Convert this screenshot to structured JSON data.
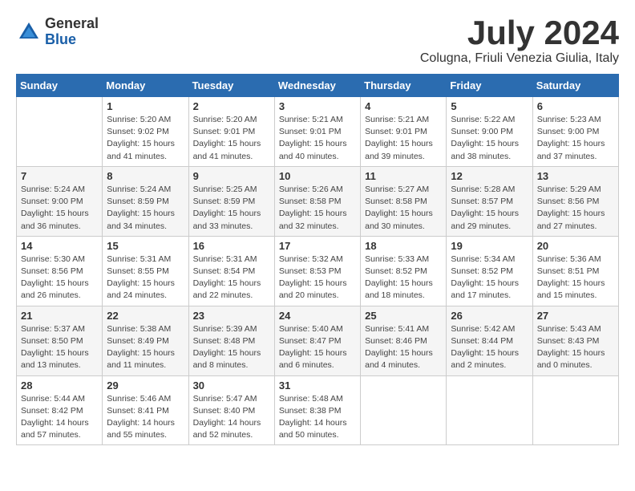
{
  "header": {
    "logo": {
      "general": "General",
      "blue": "Blue"
    },
    "title": "July 2024",
    "location": "Colugna, Friuli Venezia Giulia, Italy"
  },
  "calendar": {
    "weekdays": [
      "Sunday",
      "Monday",
      "Tuesday",
      "Wednesday",
      "Thursday",
      "Friday",
      "Saturday"
    ],
    "weeks": [
      [
        {
          "day": "",
          "info": ""
        },
        {
          "day": "1",
          "info": "Sunrise: 5:20 AM\nSunset: 9:02 PM\nDaylight: 15 hours\nand 41 minutes."
        },
        {
          "day": "2",
          "info": "Sunrise: 5:20 AM\nSunset: 9:01 PM\nDaylight: 15 hours\nand 41 minutes."
        },
        {
          "day": "3",
          "info": "Sunrise: 5:21 AM\nSunset: 9:01 PM\nDaylight: 15 hours\nand 40 minutes."
        },
        {
          "day": "4",
          "info": "Sunrise: 5:21 AM\nSunset: 9:01 PM\nDaylight: 15 hours\nand 39 minutes."
        },
        {
          "day": "5",
          "info": "Sunrise: 5:22 AM\nSunset: 9:00 PM\nDaylight: 15 hours\nand 38 minutes."
        },
        {
          "day": "6",
          "info": "Sunrise: 5:23 AM\nSunset: 9:00 PM\nDaylight: 15 hours\nand 37 minutes."
        }
      ],
      [
        {
          "day": "7",
          "info": "Sunrise: 5:24 AM\nSunset: 9:00 PM\nDaylight: 15 hours\nand 36 minutes."
        },
        {
          "day": "8",
          "info": "Sunrise: 5:24 AM\nSunset: 8:59 PM\nDaylight: 15 hours\nand 34 minutes."
        },
        {
          "day": "9",
          "info": "Sunrise: 5:25 AM\nSunset: 8:59 PM\nDaylight: 15 hours\nand 33 minutes."
        },
        {
          "day": "10",
          "info": "Sunrise: 5:26 AM\nSunset: 8:58 PM\nDaylight: 15 hours\nand 32 minutes."
        },
        {
          "day": "11",
          "info": "Sunrise: 5:27 AM\nSunset: 8:58 PM\nDaylight: 15 hours\nand 30 minutes."
        },
        {
          "day": "12",
          "info": "Sunrise: 5:28 AM\nSunset: 8:57 PM\nDaylight: 15 hours\nand 29 minutes."
        },
        {
          "day": "13",
          "info": "Sunrise: 5:29 AM\nSunset: 8:56 PM\nDaylight: 15 hours\nand 27 minutes."
        }
      ],
      [
        {
          "day": "14",
          "info": "Sunrise: 5:30 AM\nSunset: 8:56 PM\nDaylight: 15 hours\nand 26 minutes."
        },
        {
          "day": "15",
          "info": "Sunrise: 5:31 AM\nSunset: 8:55 PM\nDaylight: 15 hours\nand 24 minutes."
        },
        {
          "day": "16",
          "info": "Sunrise: 5:31 AM\nSunset: 8:54 PM\nDaylight: 15 hours\nand 22 minutes."
        },
        {
          "day": "17",
          "info": "Sunrise: 5:32 AM\nSunset: 8:53 PM\nDaylight: 15 hours\nand 20 minutes."
        },
        {
          "day": "18",
          "info": "Sunrise: 5:33 AM\nSunset: 8:52 PM\nDaylight: 15 hours\nand 18 minutes."
        },
        {
          "day": "19",
          "info": "Sunrise: 5:34 AM\nSunset: 8:52 PM\nDaylight: 15 hours\nand 17 minutes."
        },
        {
          "day": "20",
          "info": "Sunrise: 5:36 AM\nSunset: 8:51 PM\nDaylight: 15 hours\nand 15 minutes."
        }
      ],
      [
        {
          "day": "21",
          "info": "Sunrise: 5:37 AM\nSunset: 8:50 PM\nDaylight: 15 hours\nand 13 minutes."
        },
        {
          "day": "22",
          "info": "Sunrise: 5:38 AM\nSunset: 8:49 PM\nDaylight: 15 hours\nand 11 minutes."
        },
        {
          "day": "23",
          "info": "Sunrise: 5:39 AM\nSunset: 8:48 PM\nDaylight: 15 hours\nand 8 minutes."
        },
        {
          "day": "24",
          "info": "Sunrise: 5:40 AM\nSunset: 8:47 PM\nDaylight: 15 hours\nand 6 minutes."
        },
        {
          "day": "25",
          "info": "Sunrise: 5:41 AM\nSunset: 8:46 PM\nDaylight: 15 hours\nand 4 minutes."
        },
        {
          "day": "26",
          "info": "Sunrise: 5:42 AM\nSunset: 8:44 PM\nDaylight: 15 hours\nand 2 minutes."
        },
        {
          "day": "27",
          "info": "Sunrise: 5:43 AM\nSunset: 8:43 PM\nDaylight: 15 hours\nand 0 minutes."
        }
      ],
      [
        {
          "day": "28",
          "info": "Sunrise: 5:44 AM\nSunset: 8:42 PM\nDaylight: 14 hours\nand 57 minutes."
        },
        {
          "day": "29",
          "info": "Sunrise: 5:46 AM\nSunset: 8:41 PM\nDaylight: 14 hours\nand 55 minutes."
        },
        {
          "day": "30",
          "info": "Sunrise: 5:47 AM\nSunset: 8:40 PM\nDaylight: 14 hours\nand 52 minutes."
        },
        {
          "day": "31",
          "info": "Sunrise: 5:48 AM\nSunset: 8:38 PM\nDaylight: 14 hours\nand 50 minutes."
        },
        {
          "day": "",
          "info": ""
        },
        {
          "day": "",
          "info": ""
        },
        {
          "day": "",
          "info": ""
        }
      ]
    ]
  }
}
